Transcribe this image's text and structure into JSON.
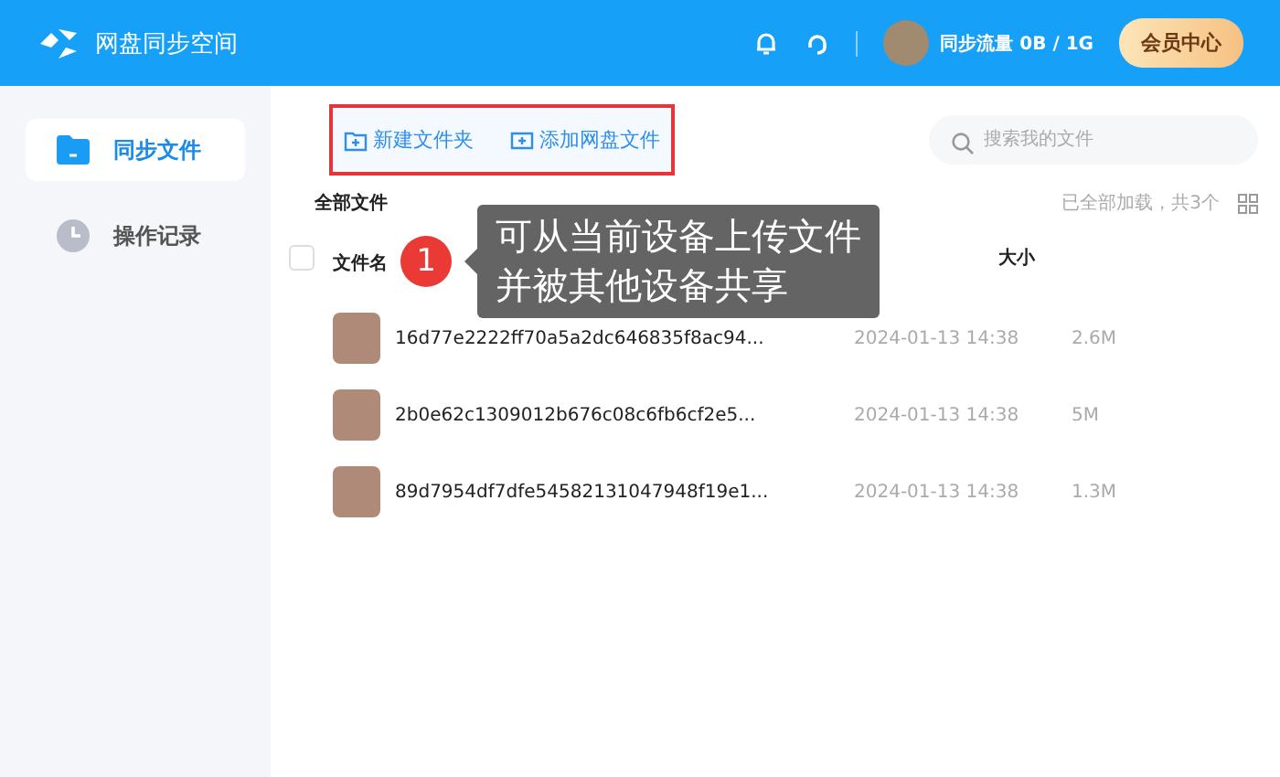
{
  "header": {
    "title": "网盘同步空间",
    "quota": "同步流量 0B / 1G",
    "vip_button": "会员中心"
  },
  "sidebar": {
    "items": [
      {
        "label": "同步文件",
        "selected": true
      },
      {
        "label": "操作记录",
        "selected": false
      }
    ]
  },
  "toolbar": {
    "buttons": [
      {
        "label": "新建文件夹"
      },
      {
        "label": "添加网盘文件"
      }
    ],
    "search": {
      "placeholder": "搜索我的文件"
    }
  },
  "list": {
    "title": "全部文件",
    "status": "已全部加载，共3个",
    "select_all": {
      "checked": false
    },
    "columns": [
      "文件名",
      "大小"
    ],
    "rows": [
      {
        "name": "16d77e2222ff70a5a2dc646835f8ac94...",
        "time": "2024-01-13 14:38",
        "size": "2.6M"
      },
      {
        "name": "2b0e62c1309012b676c08c6fb6cf2e5...",
        "time": "2024-01-13 14:38",
        "size": "5M"
      },
      {
        "name": "89d7954df7dfe54582131047948f19e1...",
        "time": "2024-01-13 14:38",
        "size": "1.3M"
      }
    ]
  },
  "guide": {
    "step": "1",
    "lines": [
      "可从当前设备上传文件",
      "并被其他设备共享"
    ]
  }
}
